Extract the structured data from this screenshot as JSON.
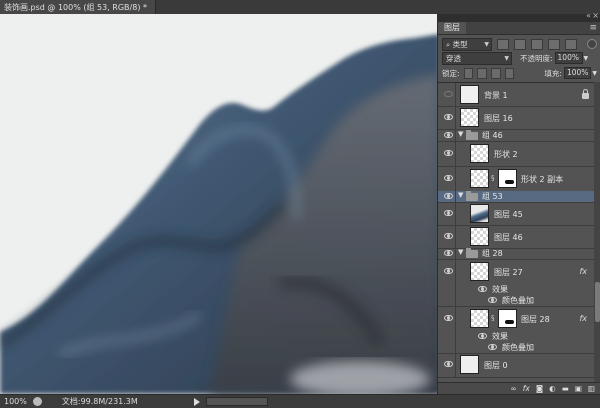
{
  "document": {
    "tab_title": "装饰画.psd @ 100% (组 53, RGB/8) *",
    "zoom": "100%",
    "doc_info": "文档:99.8M/231.3M"
  },
  "panel": {
    "tab": "图层",
    "filter_kind": "类型",
    "blend_mode": "穿透",
    "opacity_label": "不透明度:",
    "opacity_value": "100%",
    "lock_label": "锁定:",
    "fill_label": "填充:",
    "fill_value": "100%",
    "footer_icons": [
      "link-icon",
      "fx-icon",
      "mask-icon",
      "adjustment-icon",
      "group-icon",
      "new-layer-icon",
      "trash-icon"
    ]
  },
  "layers": [
    {
      "name": "背景 1",
      "type": "layer",
      "thumb": "white",
      "visible": false,
      "locked": true
    },
    {
      "name": "图层 16",
      "type": "layer",
      "thumb": "checker",
      "visible": true
    },
    {
      "name": "组 46",
      "type": "group",
      "visible": true
    },
    {
      "name": "形状 2",
      "type": "layer",
      "thumb": "checker",
      "visible": true
    },
    {
      "name": "形状 2 副本",
      "type": "layer",
      "thumb": "checker",
      "mask": true,
      "visible": true
    },
    {
      "name": "组 53",
      "type": "group",
      "visible": true,
      "selected": true
    },
    {
      "name": "图层 45",
      "type": "layer",
      "thumb": "blue",
      "visible": true
    },
    {
      "name": "图层 46",
      "type": "layer",
      "thumb": "checker",
      "visible": true
    },
    {
      "name": "组 28",
      "type": "group",
      "visible": true
    },
    {
      "name": "图层 27",
      "type": "layer",
      "thumb": "checker",
      "visible": true,
      "fx": "fx"
    },
    {
      "name": "效果",
      "type": "effect-header",
      "visible": true
    },
    {
      "name": "颜色叠加",
      "type": "effect",
      "visible": true
    },
    {
      "name": "图层 28",
      "type": "layer",
      "thumb": "checker",
      "mask": true,
      "visible": true,
      "fx": "fx"
    },
    {
      "name": "效果",
      "type": "effect-header",
      "visible": true
    },
    {
      "name": "颜色叠加",
      "type": "effect",
      "visible": true
    },
    {
      "name": "图层 0",
      "type": "layer",
      "thumb": "white",
      "visible": true
    }
  ]
}
